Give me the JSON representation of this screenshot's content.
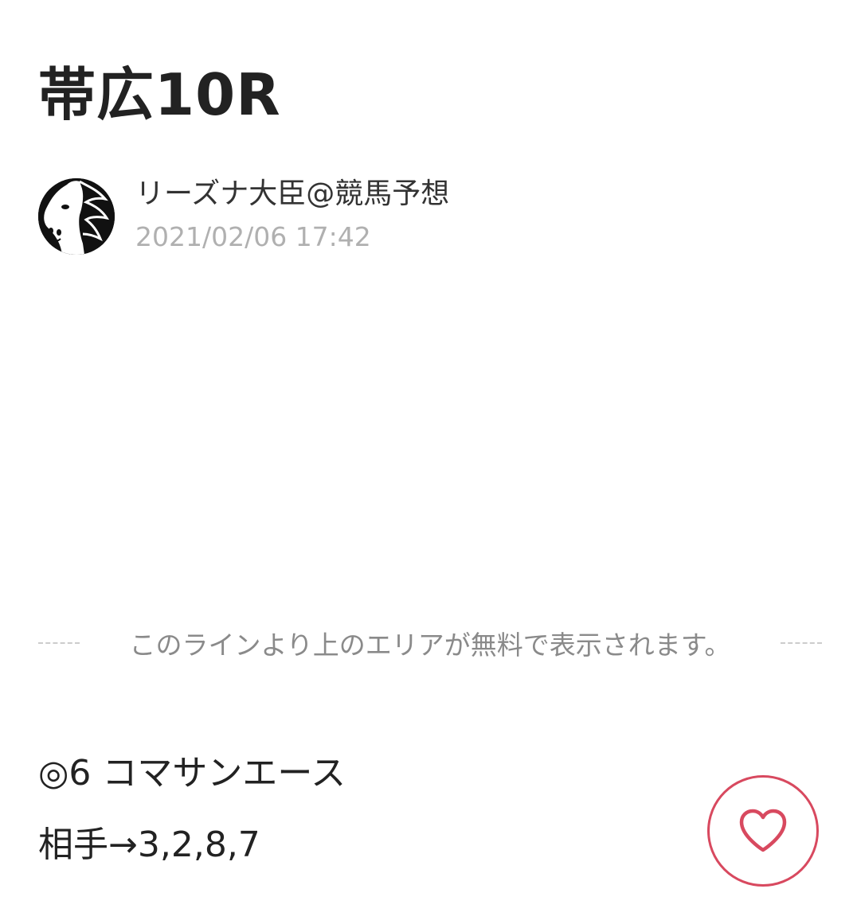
{
  "article": {
    "title": "帯広10R"
  },
  "author": {
    "name": "リーズナ大臣@競馬予想",
    "date": "2021/02/06 17:42",
    "avatar_icon": "horse-head-avatar"
  },
  "divider": {
    "text": "このラインより上のエリアが無料で表示されます。"
  },
  "body": {
    "line1": "◎6 コマサンエース",
    "line2": "相手→3,2,8,7"
  },
  "like": {
    "icon": "heart-icon",
    "color": "#d8495f"
  }
}
